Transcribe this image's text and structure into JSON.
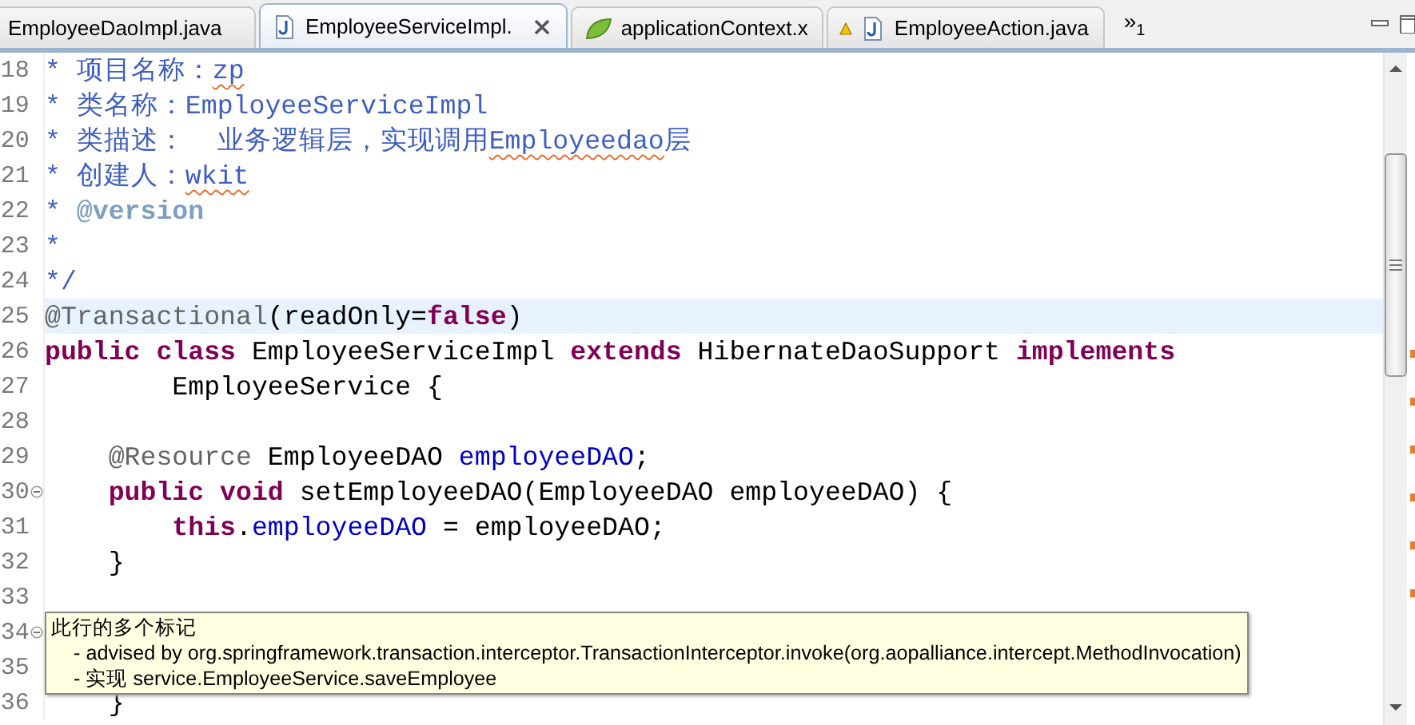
{
  "tabs": [
    {
      "label": "EmployeeDaoImpl.java",
      "kind": "plain",
      "warning": false,
      "selected": false
    },
    {
      "label": "EmployeeServiceImpl.",
      "kind": "java",
      "warning": false,
      "selected": true
    },
    {
      "label": "applicationContext.x",
      "kind": "spring",
      "warning": false,
      "selected": false
    },
    {
      "label": "EmployeeAction.java",
      "kind": "java",
      "warning": true,
      "selected": false
    }
  ],
  "overflow": {
    "glyph": "»",
    "count": "1"
  },
  "lines": [
    {
      "number": "18",
      "fold": false,
      "current": false,
      "tokens": [
        {
          "text": "* 项目名称：",
          "kind": "comment"
        },
        {
          "text": "zp",
          "kind": "comment",
          "misspelled": true
        }
      ]
    },
    {
      "number": "19",
      "fold": false,
      "current": false,
      "tokens": [
        {
          "text": "* 类名称：EmployeeServiceImpl",
          "kind": "comment"
        }
      ]
    },
    {
      "number": "20",
      "fold": false,
      "current": false,
      "tokens": [
        {
          "text": "* 类描述：  业务逻辑层，实现调用",
          "kind": "comment"
        },
        {
          "text": "Employeedao",
          "kind": "comment",
          "misspelled": true
        },
        {
          "text": "层",
          "kind": "comment"
        }
      ]
    },
    {
      "number": "21",
      "fold": false,
      "current": false,
      "tokens": [
        {
          "text": "* 创建人：",
          "kind": "comment"
        },
        {
          "text": "wkit",
          "kind": "comment",
          "misspelled": true
        }
      ]
    },
    {
      "number": "22",
      "fold": false,
      "current": false,
      "tokens": [
        {
          "text": "* ",
          "kind": "comment"
        },
        {
          "text": "@version",
          "kind": "doctag"
        }
      ]
    },
    {
      "number": "23",
      "fold": false,
      "current": false,
      "tokens": [
        {
          "text": "*",
          "kind": "comment"
        }
      ]
    },
    {
      "number": "24",
      "fold": false,
      "current": false,
      "tokens": [
        {
          "text": "*/",
          "kind": "comment"
        }
      ]
    },
    {
      "number": "25",
      "fold": false,
      "current": true,
      "tokens": [
        {
          "text": "@Transactional",
          "kind": "annotation"
        },
        {
          "text": "(readOnly=",
          "kind": "plain"
        },
        {
          "text": "false",
          "kind": "keyword"
        },
        {
          "text": ")",
          "kind": "plain"
        }
      ]
    },
    {
      "number": "26",
      "fold": false,
      "current": false,
      "tokens": [
        {
          "text": "public class",
          "kind": "keyword"
        },
        {
          "text": " EmployeeServiceImpl ",
          "kind": "plain"
        },
        {
          "text": "extends",
          "kind": "keyword"
        },
        {
          "text": " HibernateDaoSupport ",
          "kind": "plain"
        },
        {
          "text": "implements",
          "kind": "keyword"
        }
      ]
    },
    {
      "number": "27",
      "fold": false,
      "current": false,
      "tokens": [
        {
          "text": "        EmployeeService {",
          "kind": "plain"
        }
      ]
    },
    {
      "number": "28",
      "fold": false,
      "current": false
    },
    {
      "number": "29",
      "fold": false,
      "current": false,
      "tokens": [
        {
          "text": "    @Resource",
          "kind": "annotation"
        },
        {
          "text": " EmployeeDAO ",
          "kind": "plain"
        },
        {
          "text": "employeeDAO",
          "kind": "field"
        },
        {
          "text": ";",
          "kind": "plain"
        }
      ]
    },
    {
      "number": "30",
      "fold": true,
      "current": false,
      "tokens": [
        {
          "text": "    public void",
          "kind": "keyword"
        },
        {
          "text": " setEmployeeDAO(EmployeeDAO employeeDAO) {",
          "kind": "plain"
        }
      ]
    },
    {
      "number": "31",
      "fold": false,
      "current": false,
      "tokens": [
        {
          "text": "        this",
          "kind": "keyword"
        },
        {
          "text": ".",
          "kind": "plain"
        },
        {
          "text": "employeeDAO",
          "kind": "field"
        },
        {
          "text": " = employeeDAO;",
          "kind": "plain"
        }
      ]
    },
    {
      "number": "32",
      "fold": false,
      "current": false,
      "tokens": [
        {
          "text": "    }",
          "kind": "plain"
        }
      ]
    },
    {
      "number": "33",
      "fold": false,
      "current": false
    },
    {
      "number": "34",
      "fold": true,
      "current": false
    },
    {
      "number": "35",
      "fold": false,
      "current": false
    },
    {
      "number": "36",
      "fold": false,
      "current": false,
      "tokens": [
        {
          "text": "    }",
          "kind": "plain"
        }
      ]
    }
  ],
  "tooltip": {
    "title": "此行的多个标记",
    "items": [
      "- advised by org.springframework.transaction.interceptor.TransactionInterceptor.invoke(org.aopalliance.intercept.MethodInvocation)",
      "- 实现 service.EmployeeService.saveEmployee"
    ]
  }
}
